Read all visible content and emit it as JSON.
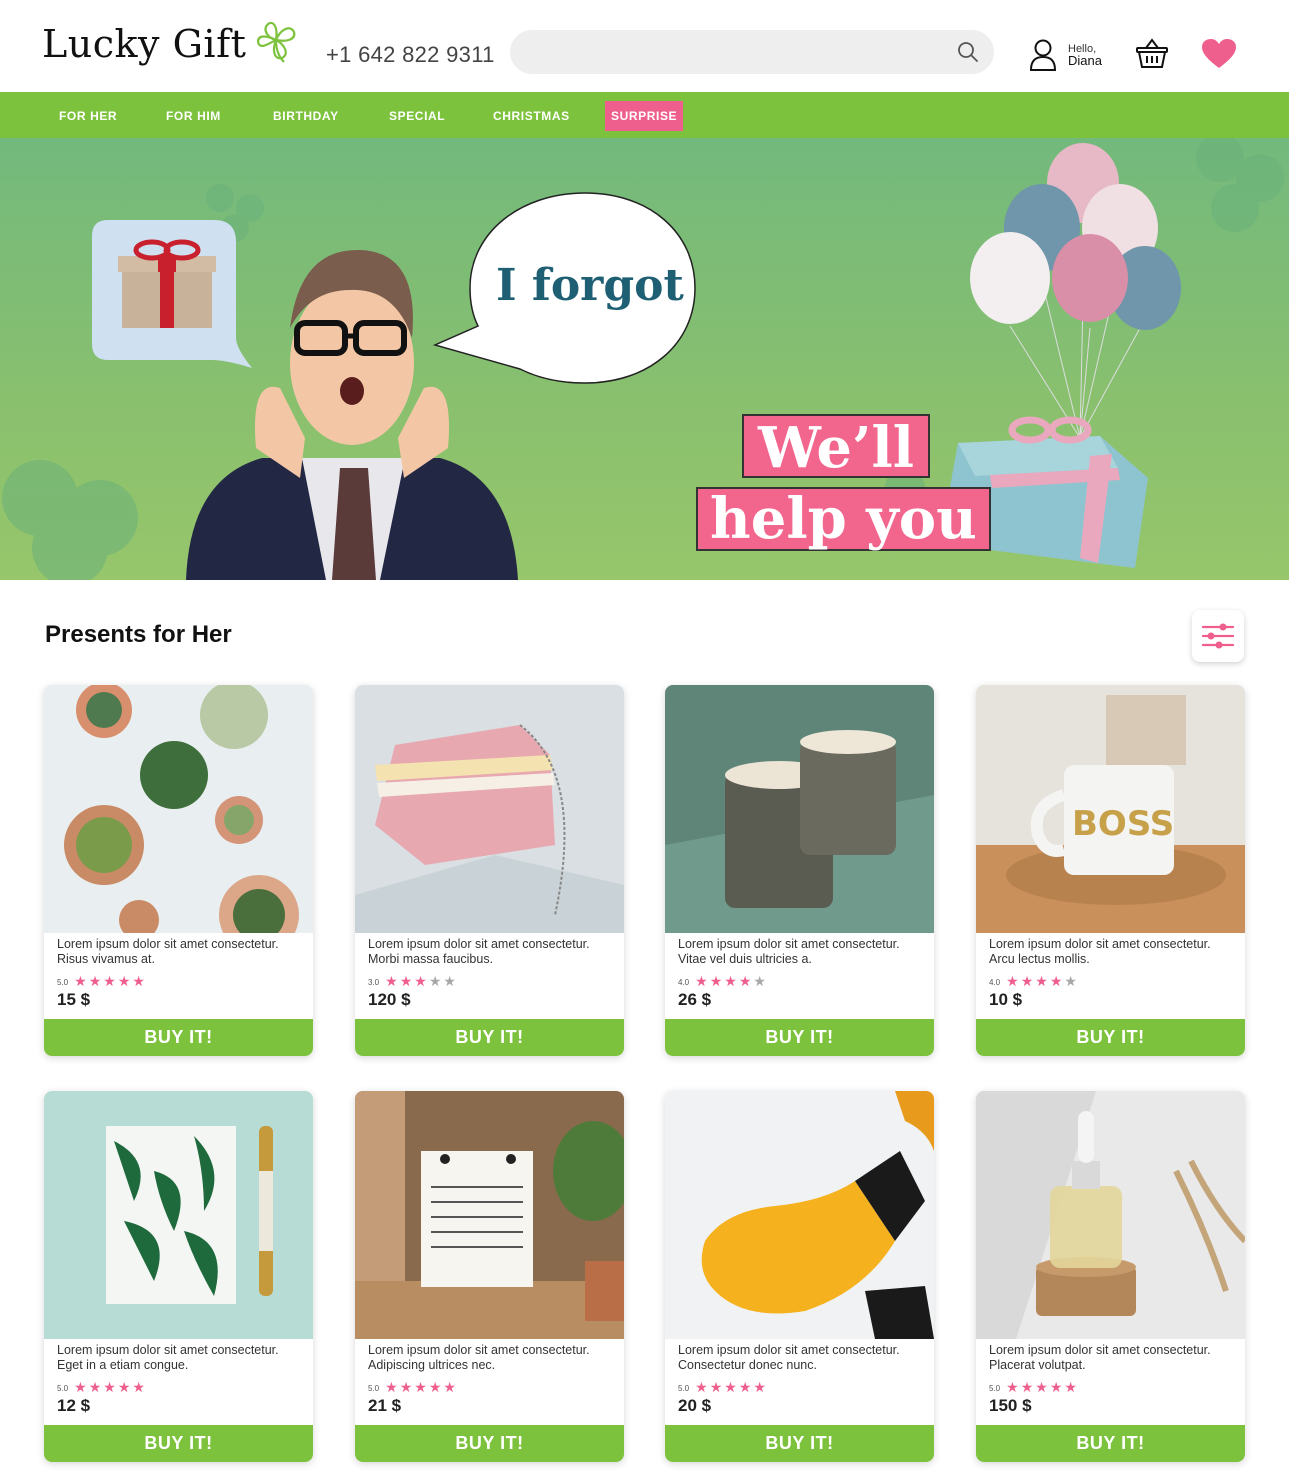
{
  "brand": {
    "name": "Lucky Gift"
  },
  "header": {
    "phone": "+1 642 822 9311",
    "search_placeholder": "",
    "greeting": "Hello,",
    "user_name": "Diana"
  },
  "nav": {
    "items": [
      {
        "label": "FOR HER"
      },
      {
        "label": "FOR HIM"
      },
      {
        "label": "BIRTHDAY"
      },
      {
        "label": "SPECIAL"
      },
      {
        "label": "CHRISTMAS"
      },
      {
        "label": "SURPRISE"
      }
    ]
  },
  "hero": {
    "bubble_text": "I forgot",
    "tagline_line1": "We’ll",
    "tagline_line2": "help you"
  },
  "section": {
    "title": "Presents for Her"
  },
  "products": [
    {
      "desc": "Lorem ipsum dolor sit amet consectetur. Risus vivamus at.",
      "rating": "5.0",
      "stars": 5,
      "price": "15 $",
      "button": "BUY IT!"
    },
    {
      "desc": "Lorem ipsum dolor sit amet consectetur. Morbi massa faucibus.",
      "rating": "3.0",
      "stars": 3,
      "price": "120 $",
      "button": "BUY IT!"
    },
    {
      "desc": "Lorem ipsum dolor sit amet consectetur. Vitae vel duis ultricies a.",
      "rating": "4.0",
      "stars": 4,
      "price": "26 $",
      "button": "BUY IT!"
    },
    {
      "desc": "Lorem ipsum dolor sit amet consectetur. Arcu lectus mollis.",
      "rating": "4.0",
      "stars": 4,
      "price": "10 $",
      "button": "BUY IT!"
    },
    {
      "desc": "Lorem ipsum dolor sit amet consectetur. Eget in a etiam congue.",
      "rating": "5.0",
      "stars": 5,
      "price": "12 $",
      "button": "BUY IT!"
    },
    {
      "desc": "Lorem ipsum dolor sit amet consectetur. Adipiscing ultrices nec.",
      "rating": "5.0",
      "stars": 5,
      "price": "21 $",
      "button": "BUY IT!"
    },
    {
      "desc": "Lorem ipsum dolor sit amet consectetur. Consectetur donec nunc.",
      "rating": "5.0",
      "stars": 5,
      "price": "20 $",
      "button": "BUY IT!"
    },
    {
      "desc": "Lorem ipsum dolor sit amet consectetur. Placerat volutpat.",
      "rating": "5.0",
      "stars": 5,
      "price": "150 $",
      "button": "BUY IT!"
    }
  ],
  "colors": {
    "accent_green": "#7dc23d",
    "accent_pink": "#ef5f8d"
  }
}
